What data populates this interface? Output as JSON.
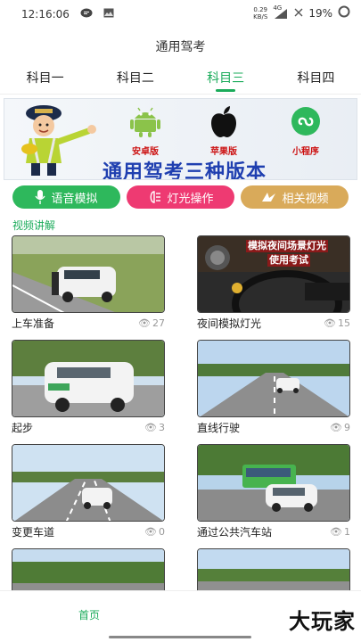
{
  "status_bar": {
    "time": "12:16:06",
    "net_speed_value": "0.29",
    "net_speed_unit": "KB/S",
    "signal_label": "4G",
    "battery": "19%"
  },
  "app": {
    "title": "通用驾考"
  },
  "tabs": [
    {
      "label": "科目一"
    },
    {
      "label": "科目二"
    },
    {
      "label": "科目三"
    },
    {
      "label": "科目四"
    }
  ],
  "banner": {
    "versions": [
      {
        "label": "安卓版",
        "icon": "android-icon"
      },
      {
        "label": "苹果版",
        "icon": "apple-icon"
      },
      {
        "label": "小程序",
        "icon": "mini-program-icon"
      }
    ],
    "headline": "通用驾考三种版本"
  },
  "actions": [
    {
      "label": "语音模拟",
      "icon": "microphone-icon",
      "color": "#2eb85c"
    },
    {
      "label": "灯光操作",
      "icon": "light-icon",
      "color": "#ee3a72"
    },
    {
      "label": "相关视频",
      "icon": "video-icon",
      "color": "#d9aa5a"
    }
  ],
  "section": {
    "title": "视频讲解"
  },
  "videos": [
    {
      "title": "上车准备",
      "views": "27"
    },
    {
      "title": "夜间模拟灯光",
      "views": "15",
      "thumb_caption_1": "模拟夜间场景灯光",
      "thumb_caption_2": "使用考试"
    },
    {
      "title": "起步",
      "views": "3"
    },
    {
      "title": "直线行驶",
      "views": "9"
    },
    {
      "title": "变更车道",
      "views": "0"
    },
    {
      "title": "通过公共汽车站",
      "views": "1"
    },
    {
      "title": "",
      "views": ""
    },
    {
      "title": "",
      "views": ""
    }
  ],
  "bottom_nav": {
    "home_label": "首页"
  },
  "watermark": "大玩家",
  "colors": {
    "accent": "#1aab5a",
    "banner_text": "#1f3fb0",
    "version_label": "#cc1111"
  }
}
